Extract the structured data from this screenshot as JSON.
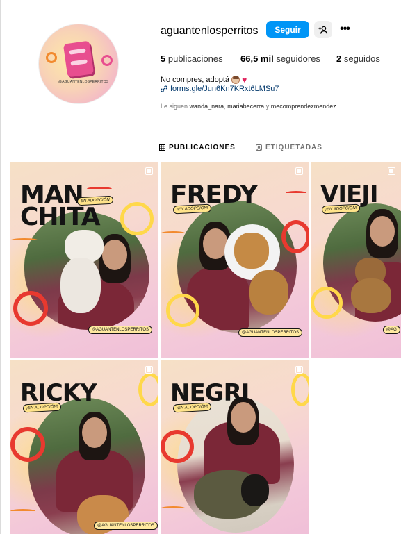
{
  "profile": {
    "username": "aguantenlosperritos",
    "follow_label": "Seguir",
    "more_label": "•••",
    "avatar_tag": "@AGUANTENLOSPERRITOS",
    "stats": {
      "posts_count": "5",
      "posts_label": "publicaciones",
      "followers_count": "66,5 mil",
      "followers_label": "seguidores",
      "following_count": "2",
      "following_label": "seguidos"
    },
    "bio": "No compres, adoptá",
    "link": "forms.gle/Jun6Kn7KRxt6LMSu7",
    "followed_by_prefix": "Le siguen",
    "followed_by_1": "wanda_nara",
    "followed_by_sep1": ",",
    "followed_by_2": "mariabecerra",
    "followed_by_sep2": "y",
    "followed_by_3": "mecomprendezmendez"
  },
  "tabs": {
    "posts": "PUBLICACIONES",
    "tagged": "ETIQUETADAS"
  },
  "posts": [
    {
      "name_line1": "MAN",
      "name_line2": "CHITA",
      "badge": "EN ADOPCIÓN",
      "handle": "@AGUANTENLOSPERRITOS"
    },
    {
      "name_line1": "FREDY",
      "name_line2": "",
      "badge": "¡EN ADOPCIÓN!",
      "handle": "@AGUANTENLOSPERRITOS"
    },
    {
      "name_line1": "VIEJI",
      "name_line2": "",
      "badge": "¡EN ADOPCIÓN!",
      "handle": "@AG"
    },
    {
      "name_line1": "RICKY",
      "name_line2": "",
      "badge": "¡EN ADOPCIÓN!",
      "handle": "@AGUANTENLOSPERRITOS"
    },
    {
      "name_line1": "NEGRI",
      "name_line2": "",
      "badge": "¡EN ADOPCIÓN!",
      "handle": ""
    }
  ],
  "colors": {
    "follow_button": "#0095f6",
    "link": "#00376b",
    "accent_red": "#e8392f",
    "accent_yellow": "#ffd84a"
  },
  "icons": [
    "add-user-icon",
    "more-icon",
    "link-icon",
    "grid-icon",
    "tagged-icon",
    "multiple-photos-icon",
    "heart-emoji",
    "woman-emoji"
  ]
}
